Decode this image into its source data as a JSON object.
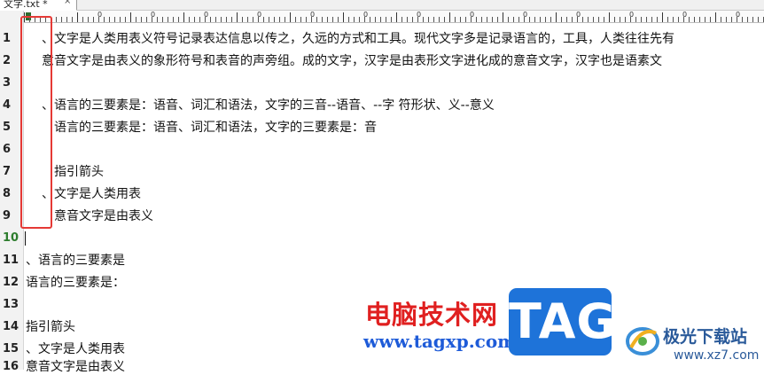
{
  "tab": {
    "label": "文字.txt *",
    "close_label": "×"
  },
  "ruler": {
    "labels": [
      "0",
      "0",
      "0",
      "0",
      "0",
      "0",
      "0",
      "0",
      "0",
      "0",
      "0",
      "0",
      "0",
      "0"
    ]
  },
  "lines": [
    {
      "num": "1",
      "text": "、文字是人类用表义符号记录表达信息以传之，久远的方式和工具。现代文字多是记录语言的，工具，人类往往先有"
    },
    {
      "num": "2",
      "text": "意音文字是由表义的象形符号和表音的声旁组。成的文字，汉字是由表形文字进化成的意音文字，汉字也是语素文"
    },
    {
      "num": "3",
      "text": ""
    },
    {
      "num": "4",
      "text": "、语言的三要素是：语音、词汇和语法，文字的三音--语音、--字 符形状、义--意义"
    },
    {
      "num": "5",
      "text": "语言的三要素是：语音、词汇和语法，文字的三要素是：音"
    },
    {
      "num": "6",
      "text": ""
    },
    {
      "num": "7",
      "text": "指引箭头"
    },
    {
      "num": "8",
      "text": "、文字是人类用表"
    },
    {
      "num": "9",
      "text": "意音文字是由表义"
    },
    {
      "num": "10",
      "text": ""
    },
    {
      "num": "11",
      "text": "、语言的三要素是"
    },
    {
      "num": "12",
      "text": "语言的三要素是："
    },
    {
      "num": "13",
      "text": ""
    },
    {
      "num": "14",
      "text": "指引箭头"
    },
    {
      "num": "15",
      "text": "、文字是人类用表"
    },
    {
      "num": "16",
      "text": "意音文字是由表义"
    }
  ],
  "watermark": {
    "site_cn": "电脑技术网",
    "site_url": "www.tagxp.com",
    "tag": "TAG",
    "logo_cn": "极光下载站",
    "logo_url": "www.xz7.com"
  },
  "colors": {
    "highlight": "#e53935",
    "current_line_number": "#2e7d2e",
    "tag_blue": "#1e73d9"
  }
}
